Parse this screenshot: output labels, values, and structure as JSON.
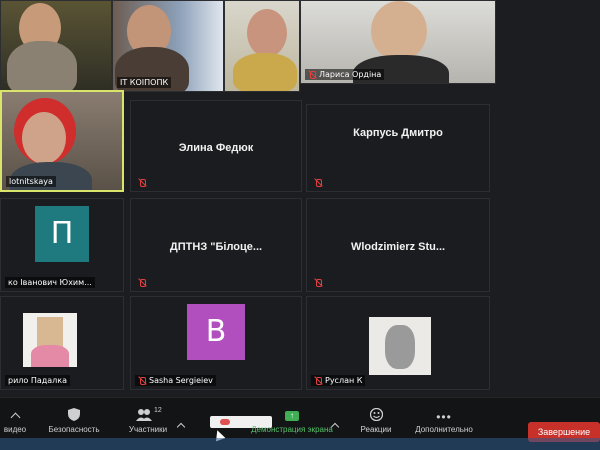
{
  "participants": [
    {
      "name": "",
      "muted": false
    },
    {
      "name": "IT КОІПОПК",
      "muted": false
    },
    {
      "name": "",
      "muted": false
    },
    {
      "name": "Лариса Ордіна",
      "muted": true
    },
    {
      "name": "lotnitskaya",
      "muted": false
    },
    {
      "name": "Элина Федюк",
      "muted": true
    },
    {
      "name": "Карпусь Дмитро",
      "muted": true
    },
    {
      "name": "ДПТНЗ \"Білоце...",
      "muted": true
    },
    {
      "name": "Wlodzimierz  Stu...",
      "muted": true
    },
    {
      "name": "ко Іванович Юхим...",
      "muted": false,
      "avatar_letter": "П",
      "avatar_color": "#1f7a80"
    },
    {
      "name": "рило Падалка",
      "muted": false
    },
    {
      "name": "Sasha Sergieiev",
      "muted": true,
      "avatar_letter": "B",
      "avatar_color": "#b24fbe"
    },
    {
      "name": "Руслан К",
      "muted": true
    }
  ],
  "toolbar": {
    "video": "видео",
    "security": "Безопасность",
    "participants": "Участники",
    "participants_count": "12",
    "share": "Демонстрация экрана",
    "reactions": "Реакции",
    "more": "Дополнительно",
    "end": "Завершение"
  }
}
